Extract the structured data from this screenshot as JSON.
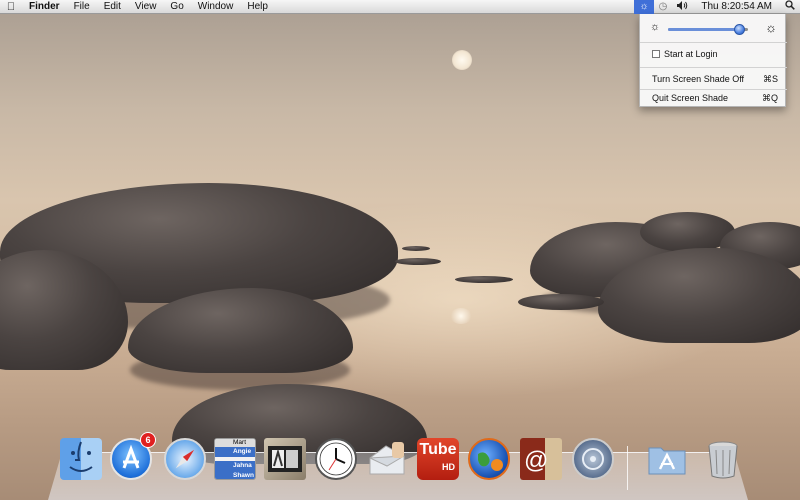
{
  "menubar": {
    "app_name": "Finder",
    "menus": [
      "File",
      "Edit",
      "View",
      "Go",
      "Window",
      "Help"
    ],
    "clock": "Thu 8:20:54 AM",
    "status_icons": [
      "screen-shade-icon",
      "time-machine-icon",
      "volume-icon",
      "spotlight-icon"
    ]
  },
  "dropdown": {
    "brightness_level": 0.95,
    "start_at_login": "Start at Login",
    "start_at_login_checked": false,
    "turn_off": "Turn Screen Shade Off",
    "turn_off_shortcut": "⌘S",
    "quit": "Quit Screen Shade",
    "quit_shortcut": "⌘Q"
  },
  "dock": {
    "appstore_badge": "6",
    "contacts_names": [
      "Mart",
      "Angie",
      "Jahna",
      "Shawn"
    ],
    "tube_label": "Tube",
    "tube_sub": "HD"
  },
  "colors": {
    "menu_highlight": "#3f6fd8",
    "badge": "#e02020"
  }
}
